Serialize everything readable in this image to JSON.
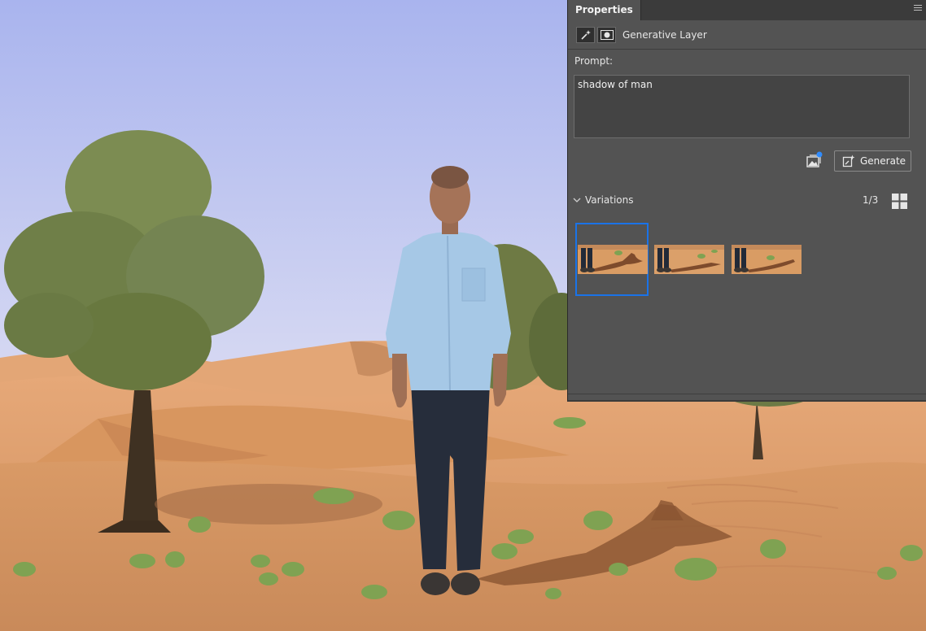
{
  "panel": {
    "tab_label": "Properties",
    "layer_type_label": "Generative Layer",
    "prompt_label": "Prompt:",
    "prompt_value": "shadow of man",
    "generate_label": "Generate",
    "variations_label": "Variations",
    "variation_counter": "1/3",
    "selected_variation": 1,
    "variation_count": 3
  },
  "icons": {
    "menu": "panel-menu-icon",
    "layer": "generative-fill-icon",
    "mask": "layer-mask-icon",
    "reference_image": "reference-image-icon",
    "generate": "generate-sparkle-icon",
    "collapse": "chevron-down-icon",
    "grid": "grid-view-icon"
  },
  "colors": {
    "panel_bg": "#535353",
    "selection": "#1a73e8",
    "sky_top": "#aeb8ee",
    "sand": "#d69a68"
  }
}
